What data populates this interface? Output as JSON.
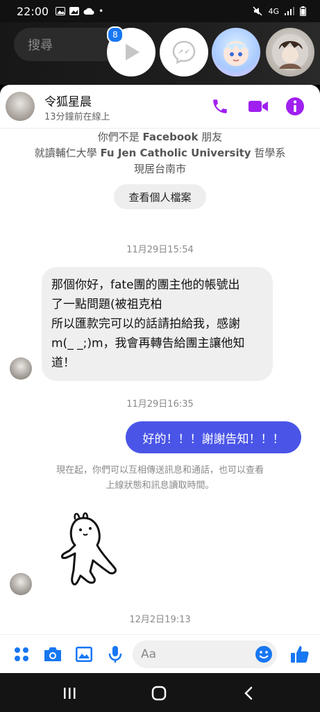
{
  "status_bar": {
    "time": "22:00",
    "dot": "•",
    "network": "4G"
  },
  "bubbles_row": {
    "search_placeholder": "搜尋",
    "badge_count": "8"
  },
  "header": {
    "name": "令狐星晨",
    "status": "13分鐘前在線上"
  },
  "profile_info": {
    "line1_prefix": "你們不是 ",
    "line1_brand": "Facebook",
    "line1_suffix": " 朋友",
    "line2_prefix": "就讀輔仁大學 ",
    "line2_school": "Fu Jen Catholic University",
    "line2_suffix": " 哲學系",
    "line3": "現居台南市",
    "view_profile": "查看個人檔案"
  },
  "messages": [
    {
      "time": "11月29日15:54"
    },
    {
      "incoming_lines": [
        "那個你好，fate團的團主他的帳號出",
        "了一點問題(被祖克柏",
        "所以匯款完可以的話請拍給我，感謝",
        "m(_ _;)m，我會再轉告給團主讓他知",
        "道！"
      ]
    },
    {
      "time": "11月29日16:35"
    },
    {
      "outgoing": "好的！！！謝謝告知！！！"
    }
  ],
  "notice": {
    "line1": "現在起，你們可以互相傳送訊息和通話，也可以查看",
    "line2": "上線狀態和訊息讀取時間。"
  },
  "last_time": "12月2日19:13",
  "composer": {
    "placeholder": "Aa"
  },
  "colors": {
    "accent_purple": "#a020f0",
    "outgoing_bubble": "#4a55e8",
    "messenger_blue": "#1877f2"
  },
  "icons": [
    "apps-icon",
    "camera-icon",
    "gallery-icon",
    "mic-icon",
    "emoji-icon",
    "thumbs-up-icon",
    "phone-icon",
    "video-icon",
    "info-icon"
  ]
}
